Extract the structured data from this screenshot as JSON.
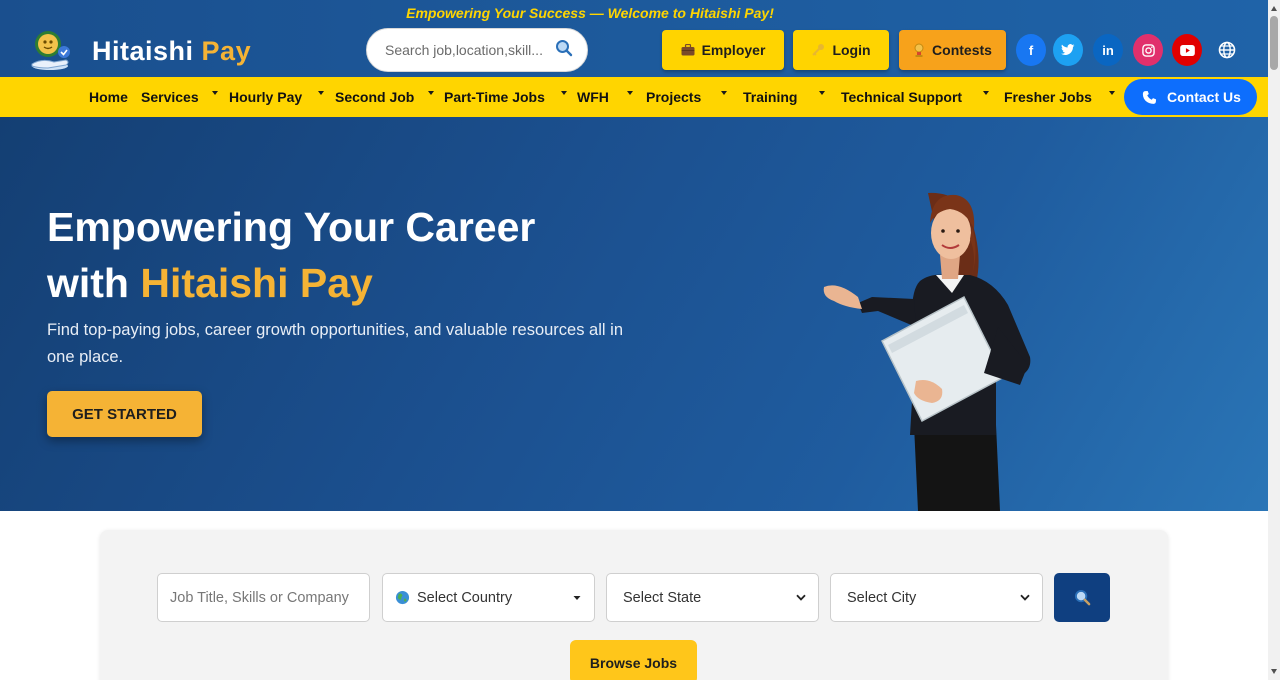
{
  "header": {
    "tagline": "Empowering Your Success — Welcome to Hitaishi Pay!",
    "logo_text_primary": "Hitaishi",
    "logo_text_accent": "Pay",
    "search_placeholder": "Search job,location,skill...",
    "buttons": {
      "employer": "Employer",
      "login": "Login",
      "contests": "Contests"
    },
    "social": {
      "facebook": "f",
      "twitter": "twitter-icon",
      "linkedin": "in",
      "instagram": "instagram-icon",
      "youtube": "youtube-icon",
      "language": "globe-icon"
    }
  },
  "nav": {
    "items": [
      "Home",
      "Services",
      "Hourly Pay",
      "Second Job",
      "Part-Time Jobs",
      "WFH",
      "Projects",
      "Training",
      "Technical Support",
      "Fresher Jobs"
    ],
    "contact_label": "Contact Us"
  },
  "hero": {
    "title_line1": "Empowering Your Career",
    "title_line2_prefix": "with",
    "title_line2_highlight": "Hitaishi Pay",
    "subtitle": "Find top-paying jobs, career growth opportunities, and valuable resources all in one place.",
    "cta_label": "GET STARTED"
  },
  "job_search": {
    "job_placeholder": "Job Title, Skills or Company",
    "country_value": "Select Country",
    "state_value": "Select State",
    "city_value": "Select City",
    "browse_label": "Browse Jobs"
  },
  "colors": {
    "header_blue": "#1d5a9c",
    "nav_yellow": "#ffd500",
    "accent_orange": "#f5b335",
    "contact_blue": "#0d6efd",
    "search_button": "#0f3f80"
  }
}
